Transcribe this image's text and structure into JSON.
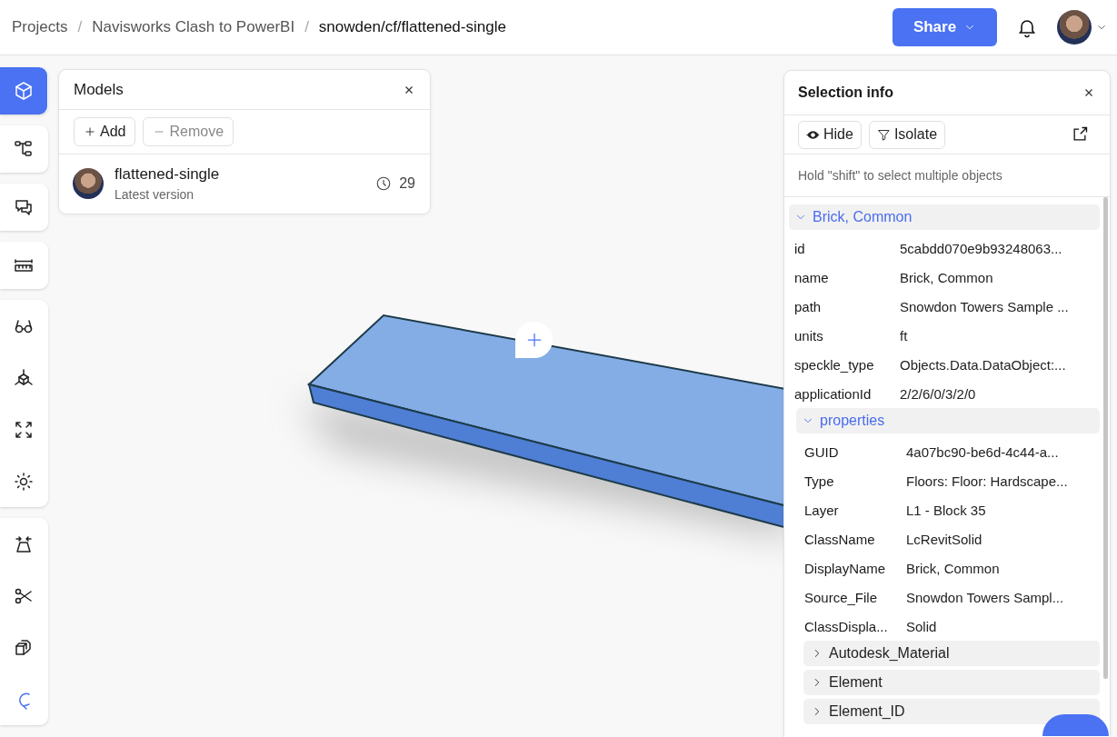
{
  "breadcrumbs": [
    {
      "label": "Projects",
      "current": false
    },
    {
      "separator": "/",
      "label": "Navisworks Clash to PowerBI",
      "current": false
    },
    {
      "separator": "/",
      "label": "snowden/cf/flattened-single",
      "current": true
    }
  ],
  "share_button": {
    "label": "Share"
  },
  "toolbar": [
    [
      {
        "selected": true
      }
    ],
    [
      {
        "selected": false
      }
    ],
    [
      {
        "selected": false
      }
    ],
    [
      {
        "selected": false
      }
    ],
    [
      {
        "selected": false
      },
      {
        "selected": false
      },
      {
        "selected": false
      },
      {
        "selected": false
      }
    ],
    [
      {
        "selected": false
      },
      {
        "selected": false
      },
      {
        "selected": false
      },
      {
        "selected": false
      }
    ]
  ],
  "models_panel": {
    "title": "Models",
    "buttons": [
      {
        "label": "Add",
        "kind": "add",
        "disabled": false
      },
      {
        "label": "Remove",
        "kind": "remove",
        "disabled": true
      }
    ],
    "models": [
      {
        "name": "flattened-single",
        "subtitle": "Latest version",
        "versions": "29"
      }
    ]
  },
  "selection_panel": {
    "title": "Selection info",
    "actions": [
      {
        "label": "Hide"
      },
      {
        "label": "Isolate"
      }
    ],
    "hint": "Hold \"shift\" to select multiple objects",
    "tree": [
      {
        "label": "Brick, Common",
        "expanded": true,
        "rows": [
          {
            "key": "id",
            "value": "5cabdd070e9b93248063..."
          },
          {
            "key": "name",
            "value": "Brick, Common"
          },
          {
            "key": "path",
            "value": "Snowdon Towers Sample ..."
          },
          {
            "key": "units",
            "value": "ft"
          },
          {
            "key": "speckle_type",
            "value": "Objects.Data.DataObject:..."
          },
          {
            "key": "applicationId",
            "value": "2/2/6/0/3/2/0"
          }
        ],
        "children": [
          {
            "label": "properties",
            "expanded": true,
            "rows": [
              {
                "key": "GUID",
                "value": "4a07bc90-be6d-4c44-a..."
              },
              {
                "key": "Type",
                "value": "Floors: Floor: Hardscape..."
              },
              {
                "key": "Layer",
                "value": "L1 - Block 35"
              },
              {
                "key": "ClassName",
                "value": "LcRevitSolid"
              },
              {
                "key": "DisplayName",
                "value": "Brick, Common"
              },
              {
                "key": "Source_File",
                "value": "Snowdon Towers Sampl..."
              },
              {
                "key": "ClassDispla...",
                "value": "Solid"
              }
            ],
            "children": [
              {
                "label": "Autodesk_Material",
                "expanded": false
              },
              {
                "label": "Element",
                "expanded": false
              },
              {
                "label": "Element_ID",
                "expanded": false
              }
            ]
          }
        ]
      }
    ]
  }
}
